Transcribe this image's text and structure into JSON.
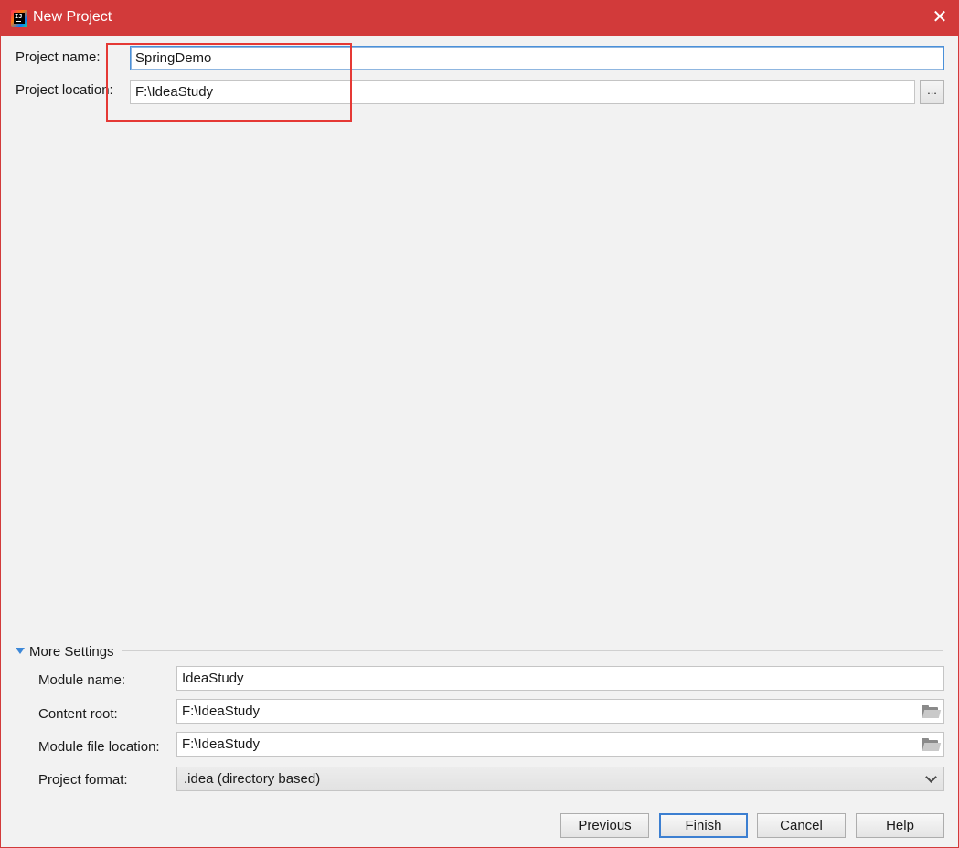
{
  "window": {
    "title": "New Project",
    "close_glyph": "✕"
  },
  "project": {
    "name_label": "Project name:",
    "name_value": "SpringDemo",
    "location_label": "Project location:",
    "location_value": "F:\\IdeaStudy",
    "browse_label": "..."
  },
  "more_settings": {
    "toggle_label": "More Settings",
    "module_name_label": "Module name:",
    "module_name_value": "IdeaStudy",
    "content_root_label": "Content root:",
    "content_root_value": "F:\\IdeaStudy",
    "module_file_location_label": "Module file location:",
    "module_file_location_value": "F:\\IdeaStudy",
    "project_format_label": "Project format:",
    "project_format_value": ".idea (directory based)"
  },
  "buttons": {
    "previous": "Previous",
    "finish": "Finish",
    "cancel": "Cancel",
    "help": "Help"
  },
  "colors": {
    "titlebar": "#d23a3a",
    "highlight_box": "#e53935",
    "focus": "#4a90d9"
  },
  "icons": {
    "app": "intellij-idea-icon",
    "close": "close-icon",
    "browse": "ellipsis-icon",
    "folder": "folder-icon",
    "expand": "triangle-down-icon",
    "dropdown": "chevron-down-icon"
  }
}
